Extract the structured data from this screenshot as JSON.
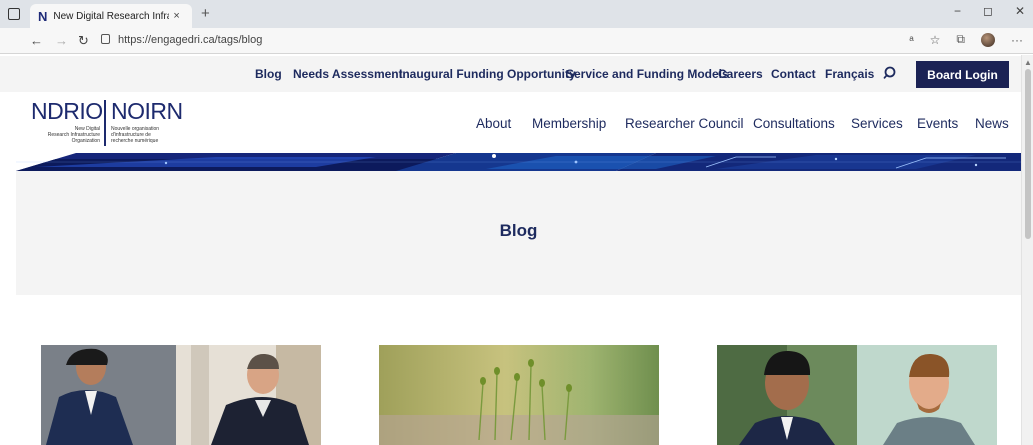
{
  "browser": {
    "tab_favicon": "N",
    "tab_title": "New Digital Research Infrastruct",
    "tab_close": "×",
    "new_tab": "+",
    "url": "https://engagedri.ca/tags/blog",
    "window_controls": [
      "−",
      "◻",
      "✕"
    ]
  },
  "topnav": {
    "items": [
      "Blog",
      "Needs Assessment",
      "Inaugural Funding Opportunity",
      "Service and Funding Models",
      "Careers",
      "Contact",
      "Français"
    ],
    "login_label": "Board Login"
  },
  "logo": {
    "left_word": "NDRIO",
    "right_word": "NOIRN",
    "subtitle_en": [
      "New Digital",
      "Research Infrastructure",
      "Organization"
    ],
    "subtitle_fr": [
      "Nouvelle organisation",
      "d'infrastructure de",
      "recherche numérique"
    ]
  },
  "mainnav": {
    "items": [
      "About",
      "Membership",
      "Researcher Council",
      "Consultations",
      "Services",
      "Events",
      "News"
    ]
  },
  "hero": {
    "title": "Blog"
  },
  "colors": {
    "navy": "#1d2a5e",
    "button": "#1b2254",
    "hero_bg": "#f4f4f4"
  },
  "posts": [
    {
      "image": "two-men-portrait-photo"
    },
    {
      "image": "moss-sprouts-photo"
    },
    {
      "image": "two-men-headshots-photo"
    }
  ]
}
